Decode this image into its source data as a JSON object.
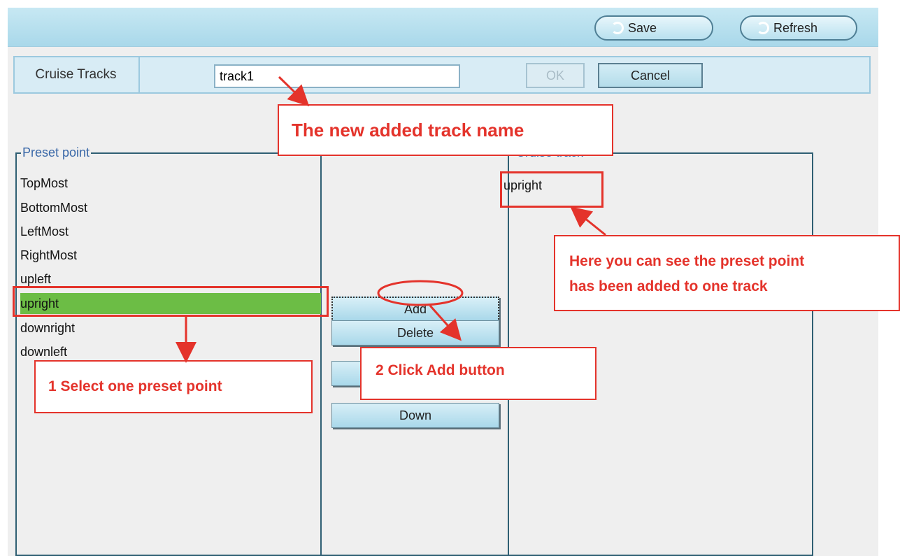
{
  "toolbar": {
    "save_label": "Save",
    "refresh_label": "Refresh"
  },
  "cruise": {
    "label": "Cruise Tracks",
    "track_name": "track1",
    "ok_label": "OK",
    "cancel_label": "Cancel"
  },
  "preset": {
    "legend": "Preset point",
    "items": [
      "TopMost",
      "BottomMost",
      "LeftMost",
      "RightMost",
      "upleft",
      "upright",
      "downright",
      "downleft"
    ],
    "selected": "upright"
  },
  "buttons": {
    "add_label": "Add",
    "delete_label": "Delete",
    "down_label": "Down"
  },
  "cruise_track": {
    "legend": "Cruise track",
    "items": [
      "upright"
    ]
  },
  "callouts": {
    "track_name": "The new added track name",
    "select_preset": "1 Select one preset point",
    "click_add": "2 Click Add button",
    "result_line1": "Here you can see the preset point",
    "result_line2": "has been added to one track"
  },
  "colors": {
    "annotation": "#e4332b",
    "selection": "#6cbd45",
    "toolbar": "#b3dded"
  }
}
